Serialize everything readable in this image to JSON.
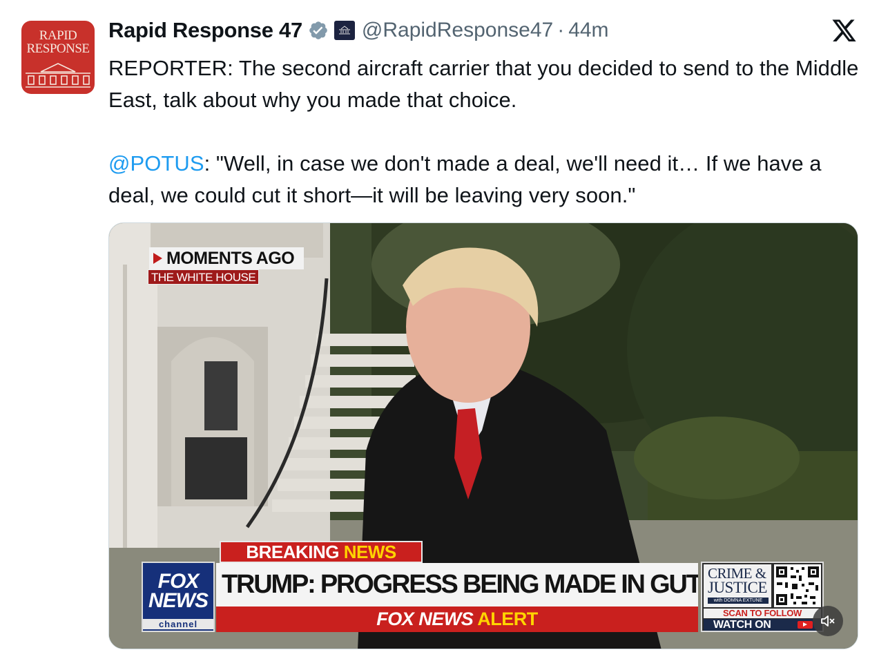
{
  "author": {
    "display_name": "Rapid Response 47",
    "handle": "@RapidResponse47",
    "time": "44m",
    "separator": "·",
    "avatar_text_line1": "RAPID",
    "avatar_text_line2": "RESPONSE",
    "verified_icon": "verified-badge-icon",
    "affiliation_icon": "white-house-badge-icon",
    "affiliation_text": "THE WHITE HOUSE"
  },
  "platform": {
    "logo_icon": "x-logo-icon"
  },
  "tweet": {
    "paragraph1": "REPORTER: The second aircraft carrier that you decided to send to the Middle East, talk about why you made that choice.",
    "mention": "@POTUS",
    "paragraph2_rest": ": \"Well, in case we don't made a deal, we'll need it… If we have a deal, we could cut it short—it will be leaving very soon.\""
  },
  "video": {
    "moments_label": "MOMENTS AGO",
    "location_label": "THE WHITE HOUSE",
    "breaking_word1": "BREAKING",
    "breaking_word2": "NEWS",
    "network_line1": "FOX",
    "network_line2": "NEWS",
    "network_line3": "channel",
    "headline": "TRUMP: PROGRESS BEING MADE IN GUTHRIE SEARCH",
    "alert_word1": "FOX NEWS",
    "alert_word2": "ALERT",
    "promo_line1": "CRIME &",
    "promo_line2": "JUSTICE",
    "promo_host": "with DOMNA EXTUNE",
    "promo_scan": "SCAN TO FOLLOW",
    "promo_watch": "WATCH ON",
    "mute_icon": "speaker-muted-icon",
    "colors": {
      "fox_blue": "#16307a",
      "alert_red": "#c9201e",
      "alert_yellow": "#ffd400"
    }
  },
  "colors": {
    "link": "#1d9bf0",
    "secondary_text": "#536471",
    "avatar_bg": "#c8312b"
  }
}
